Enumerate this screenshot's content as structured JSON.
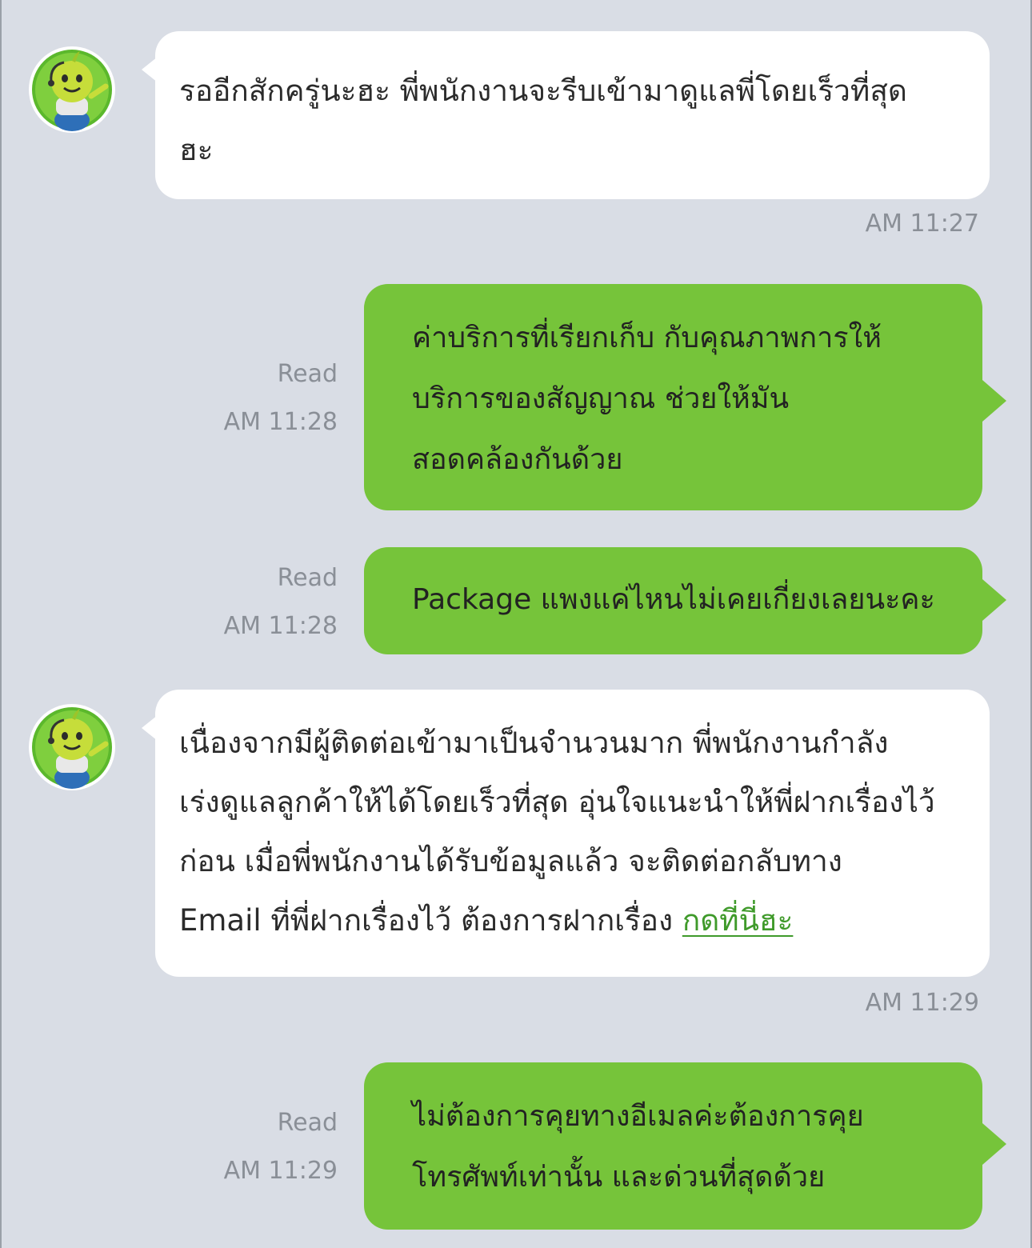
{
  "colors": {
    "background": "#d9dde5",
    "bubble_in": "#ffffff",
    "bubble_out": "#76c43a",
    "link": "#3f9a2a",
    "meta_text": "#8a8f97"
  },
  "messages": [
    {
      "sender": "bot",
      "avatar": "mascot-avatar",
      "lines": [
        "รออีกสักครู่นะฮะ พี่พนักงานจะรีบเข้ามาดูแลพี่โดยเร็วที่สุด",
        "ฮะ"
      ],
      "time": "AM 11:27"
    },
    {
      "sender": "user",
      "lines": [
        "ค่าบริการที่เรียกเก็บ กับคุณภาพการให้",
        "บริการของสัญญาณ ช่วยให้มัน",
        "สอดคล้องกันด้วย"
      ],
      "read_label": "Read",
      "time": "AM 11:28"
    },
    {
      "sender": "user",
      "lines": [
        "Package แพงแค่ไหนไม่เคยเกี่ยงเลยนะคะ"
      ],
      "read_label": "Read",
      "time": "AM 11:28"
    },
    {
      "sender": "bot",
      "avatar": "mascot-avatar",
      "lines": [
        "เนื่องจากมีผู้ติดต่อเข้ามาเป็นจำนวนมาก พี่พนักงานกำลัง",
        "เร่งดูแลลูกค้าให้ได้โดยเร็วที่สุด อุ่นใจแนะนำให้พี่ฝากเรื่องไว้",
        "ก่อน เมื่อพี่พนักงานได้รับข้อมูลแล้ว จะติดต่อกลับทาง",
        "Email ที่พี่ฝากเรื่องไว้ ต้องการฝากเรื่อง "
      ],
      "link_text": "กดที่นี่ฮะ",
      "time": "AM 11:29"
    },
    {
      "sender": "user",
      "lines": [
        "ไม่ต้องการคุยทางอีเมลค่ะต้องการคุย",
        "โทรศัพท์เท่านั้น และด่วนที่สุดด้วย"
      ],
      "read_label": "Read",
      "time": "AM 11:29"
    }
  ]
}
